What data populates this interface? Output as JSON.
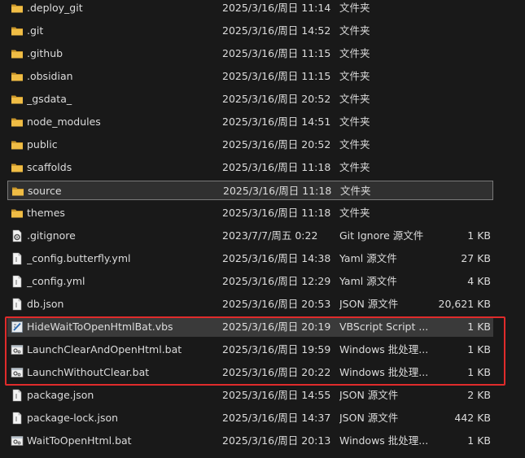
{
  "colors": {
    "background": "#191919",
    "text": "#dcdcdc",
    "folder": "#e8b53b",
    "highlight_border": "#e02b2b"
  },
  "files": [
    {
      "name": ".deploy_git",
      "date": "2025/3/16/周日 11:14",
      "type": "文件夹",
      "size": "",
      "icon": "folder-icon"
    },
    {
      "name": ".git",
      "date": "2025/3/16/周日 14:52",
      "type": "文件夹",
      "size": "",
      "icon": "folder-icon"
    },
    {
      "name": ".github",
      "date": "2025/3/16/周日 11:15",
      "type": "文件夹",
      "size": "",
      "icon": "folder-icon"
    },
    {
      "name": ".obsidian",
      "date": "2025/3/16/周日 11:15",
      "type": "文件夹",
      "size": "",
      "icon": "folder-icon"
    },
    {
      "name": "_gsdata_",
      "date": "2025/3/16/周日 20:52",
      "type": "文件夹",
      "size": "",
      "icon": "folder-icon"
    },
    {
      "name": "node_modules",
      "date": "2025/3/16/周日 14:51",
      "type": "文件夹",
      "size": "",
      "icon": "folder-icon"
    },
    {
      "name": "public",
      "date": "2025/3/16/周日 20:52",
      "type": "文件夹",
      "size": "",
      "icon": "folder-icon"
    },
    {
      "name": "scaffolds",
      "date": "2025/3/16/周日 11:18",
      "type": "文件夹",
      "size": "",
      "icon": "folder-icon"
    },
    {
      "name": "source",
      "date": "2025/3/16/周日 11:18",
      "type": "文件夹",
      "size": "",
      "icon": "folder-icon",
      "state": "selected"
    },
    {
      "name": "themes",
      "date": "2025/3/16/周日 11:18",
      "type": "文件夹",
      "size": "",
      "icon": "folder-icon"
    },
    {
      "name": ".gitignore",
      "date": "2023/7/7/周五 0:22",
      "type": "Git Ignore 源文件",
      "size": "1 KB",
      "icon": "settings-file-icon"
    },
    {
      "name": "_config.butterfly.yml",
      "date": "2025/3/16/周日 14:38",
      "type": "Yaml 源文件",
      "size": "27 KB",
      "icon": "text-file-icon"
    },
    {
      "name": "_config.yml",
      "date": "2025/3/16/周日 12:29",
      "type": "Yaml 源文件",
      "size": "4 KB",
      "icon": "text-file-icon"
    },
    {
      "name": "db.json",
      "date": "2025/3/16/周日 20:53",
      "type": "JSON 源文件",
      "size": "20,621 KB",
      "icon": "text-file-icon"
    },
    {
      "name": "HideWaitToOpenHtmlBat.vbs",
      "date": "2025/3/16/周日 20:19",
      "type": "VBScript Script ...",
      "size": "1 KB",
      "icon": "vbs-script-icon",
      "state": "hovered"
    },
    {
      "name": "LaunchClearAndOpenHtml.bat",
      "date": "2025/3/16/周日 19:59",
      "type": "Windows 批处理...",
      "size": "1 KB",
      "icon": "batch-file-icon"
    },
    {
      "name": "LaunchWithoutClear.bat",
      "date": "2025/3/16/周日 20:22",
      "type": "Windows 批处理...",
      "size": "1 KB",
      "icon": "batch-file-icon"
    },
    {
      "name": "package.json",
      "date": "2025/3/16/周日 14:55",
      "type": "JSON 源文件",
      "size": "2 KB",
      "icon": "text-file-icon"
    },
    {
      "name": "package-lock.json",
      "date": "2025/3/16/周日 14:37",
      "type": "JSON 源文件",
      "size": "442 KB",
      "icon": "text-file-icon"
    },
    {
      "name": "WaitToOpenHtml.bat",
      "date": "2025/3/16/周日 20:13",
      "type": "Windows 批处理...",
      "size": "1 KB",
      "icon": "batch-file-icon"
    }
  ]
}
